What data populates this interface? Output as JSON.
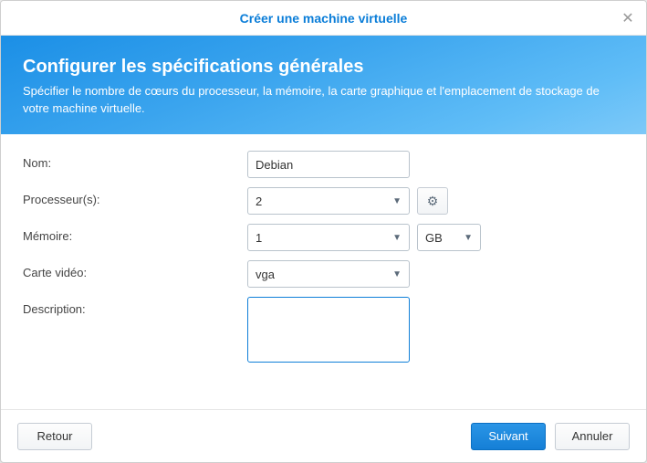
{
  "window": {
    "title": "Créer une machine virtuelle"
  },
  "banner": {
    "heading": "Configurer les spécifications générales",
    "subheading": "Spécifier le nombre de cœurs du processeur, la mémoire, la carte graphique et l'emplacement de stockage de votre machine virtuelle."
  },
  "form": {
    "name_label": "Nom:",
    "name_value": "Debian",
    "processor_label": "Processeur(s):",
    "processor_value": "2",
    "memory_label": "Mémoire:",
    "memory_value": "1",
    "memory_unit": "GB",
    "video_label": "Carte vidéo:",
    "video_value": "vga",
    "description_label": "Description:",
    "description_value": ""
  },
  "buttons": {
    "back": "Retour",
    "next": "Suivant",
    "cancel": "Annuler"
  }
}
